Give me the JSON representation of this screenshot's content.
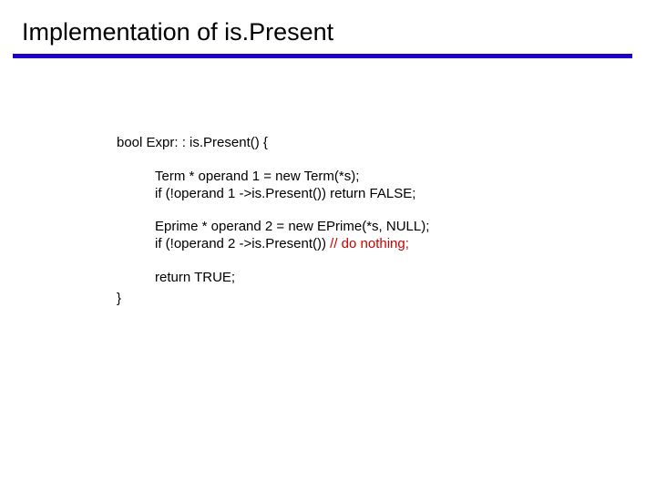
{
  "title": {
    "prefix": "Implementation of ",
    "func": "is.Present"
  },
  "code": {
    "l1": "bool Expr: : is.Present() {",
    "l2a": "Term * operand 1 = new Term(*s);",
    "l2b": "if (!operand 1 ->is.Present()) return FALSE;",
    "l3a": "Eprime * operand 2 = new EPrime(*s, NULL);",
    "l3b_pre": "if (!operand 2 ->is.Present()) ",
    "l3b_comment": "// do nothing;",
    "l4": "return TRUE;",
    "l5": "}"
  }
}
